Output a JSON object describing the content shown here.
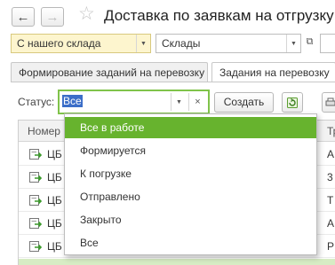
{
  "window": {
    "title": "Доставка по заявкам на отгрузку"
  },
  "toolbar": {
    "warehouse_source": "С нашего склада",
    "warehouses": "Склады"
  },
  "tabs": [
    {
      "label": "Формирование заданий на перевозку"
    },
    {
      "label": "Задания на перевозку"
    }
  ],
  "filter": {
    "status_label": "Статус:",
    "status_value": "Все",
    "create_label": "Создать"
  },
  "table": {
    "columns": [
      "Номер",
      "Тр"
    ],
    "rows": [
      {
        "number": "ЦБ",
        "tr": "А"
      },
      {
        "number": "ЦБ",
        "tr": "3"
      },
      {
        "number": "ЦБ",
        "tr": "Т"
      },
      {
        "number": "ЦБ",
        "tr": "А"
      },
      {
        "number": "ЦБ",
        "tr": "Р"
      }
    ]
  },
  "status_options": [
    {
      "label": "Все в работе",
      "selected": true
    },
    {
      "label": "Формируется"
    },
    {
      "label": "К погрузке"
    },
    {
      "label": "Отправлено"
    },
    {
      "label": "Закрыто"
    },
    {
      "label": "Все"
    }
  ],
  "colors": {
    "accent_green": "#67b32e",
    "focus_green": "#80c34a",
    "select_highlight": "#fdf5ce",
    "text_selection": "#3c6ec8"
  }
}
